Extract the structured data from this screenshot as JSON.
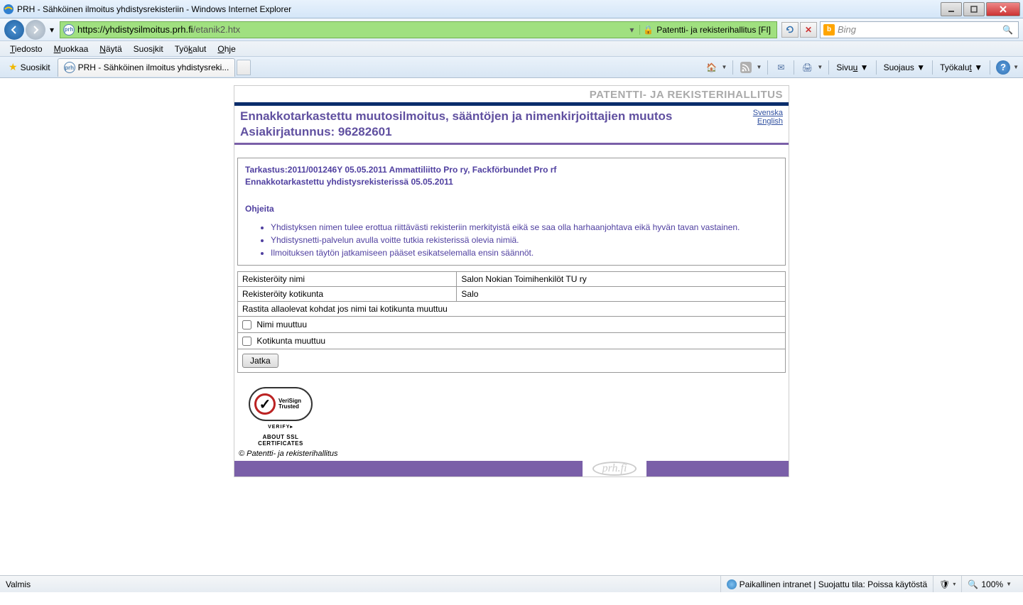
{
  "window": {
    "title": "PRH - Sähköinen ilmoitus yhdistysrekisteriin - Windows Internet Explorer"
  },
  "navbar": {
    "url_prefix": "https://",
    "url_domain": "yhdistysilmoitus.prh.fi",
    "url_path": "/etanik2.htx",
    "security_text": "Patentti- ja rekisterihallitus [FI]",
    "search_placeholder": "Bing"
  },
  "menubar": {
    "file": "Tiedosto",
    "edit": "Muokkaa",
    "view": "Näytä",
    "favorites": "Suosikit",
    "tools": "Työkalut",
    "help": "Ohje"
  },
  "toolbar": {
    "favorites": "Suosikit",
    "tab_title": "PRH - Sähköinen ilmoitus yhdistysreki...",
    "page_menu": "Sivu",
    "safety_menu": "Suojaus",
    "tools_menu": "Työkalut"
  },
  "page": {
    "header_brand": "PATENTTI- JA REKISTERIHALLITUS",
    "title_line1": "Ennakkotarkastettu muutosilmoitus, sääntöjen ja nimenkirjoittajien muutos",
    "title_line2": "Asiakirjatunnus: 96282601",
    "lang_sv": "Svenska",
    "lang_en": "English",
    "info_line1": "Tarkastus:2011/001246Y 05.05.2011 Ammattiliitto Pro ry, Fackförbundet Pro rf",
    "info_line2": "Ennakkotarkastettu yhdistysrekisterissä 05.05.2011",
    "info_heading": "Ohjeita",
    "bullet1": "Yhdistyksen nimen tulee erottua riittävästi rekisteriin merkityistä eikä se saa olla harhaanjohtava eikä hyvän tavan vastainen.",
    "bullet2": "Yhdistysnetti-palvelun avulla voitte tutkia rekisterissä olevia nimiä.",
    "bullet3": "Ilmoituksen täytön jatkamiseen pääset esikatselemalla ensin säännöt.",
    "label_name": "Rekisteröity nimi",
    "value_name": "Salon Nokian Toimihenkilöt TU ry",
    "label_home": "Rekisteröity kotikunta",
    "value_home": "Salo",
    "instruction_row": "Rastita allaolevat kohdat jos nimi tai kotikunta muuttuu",
    "checkbox1": "Nimi muuttuu",
    "checkbox2": "Kotikunta muuttuu",
    "continue_btn": "Jatka",
    "verisign_line1": "VeriSign",
    "verisign_line2": "Trusted",
    "verisign_verify": "VERIFY▸",
    "verisign_about": "ABOUT SSL CERTIFICATES",
    "copyright": "© Patentti- ja rekisterihallitus",
    "logo_text": "prh.fi"
  },
  "statusbar": {
    "status": "Valmis",
    "zone": "Paikallinen intranet | Suojattu tila: Poissa käytöstä",
    "zoom": "100%"
  }
}
